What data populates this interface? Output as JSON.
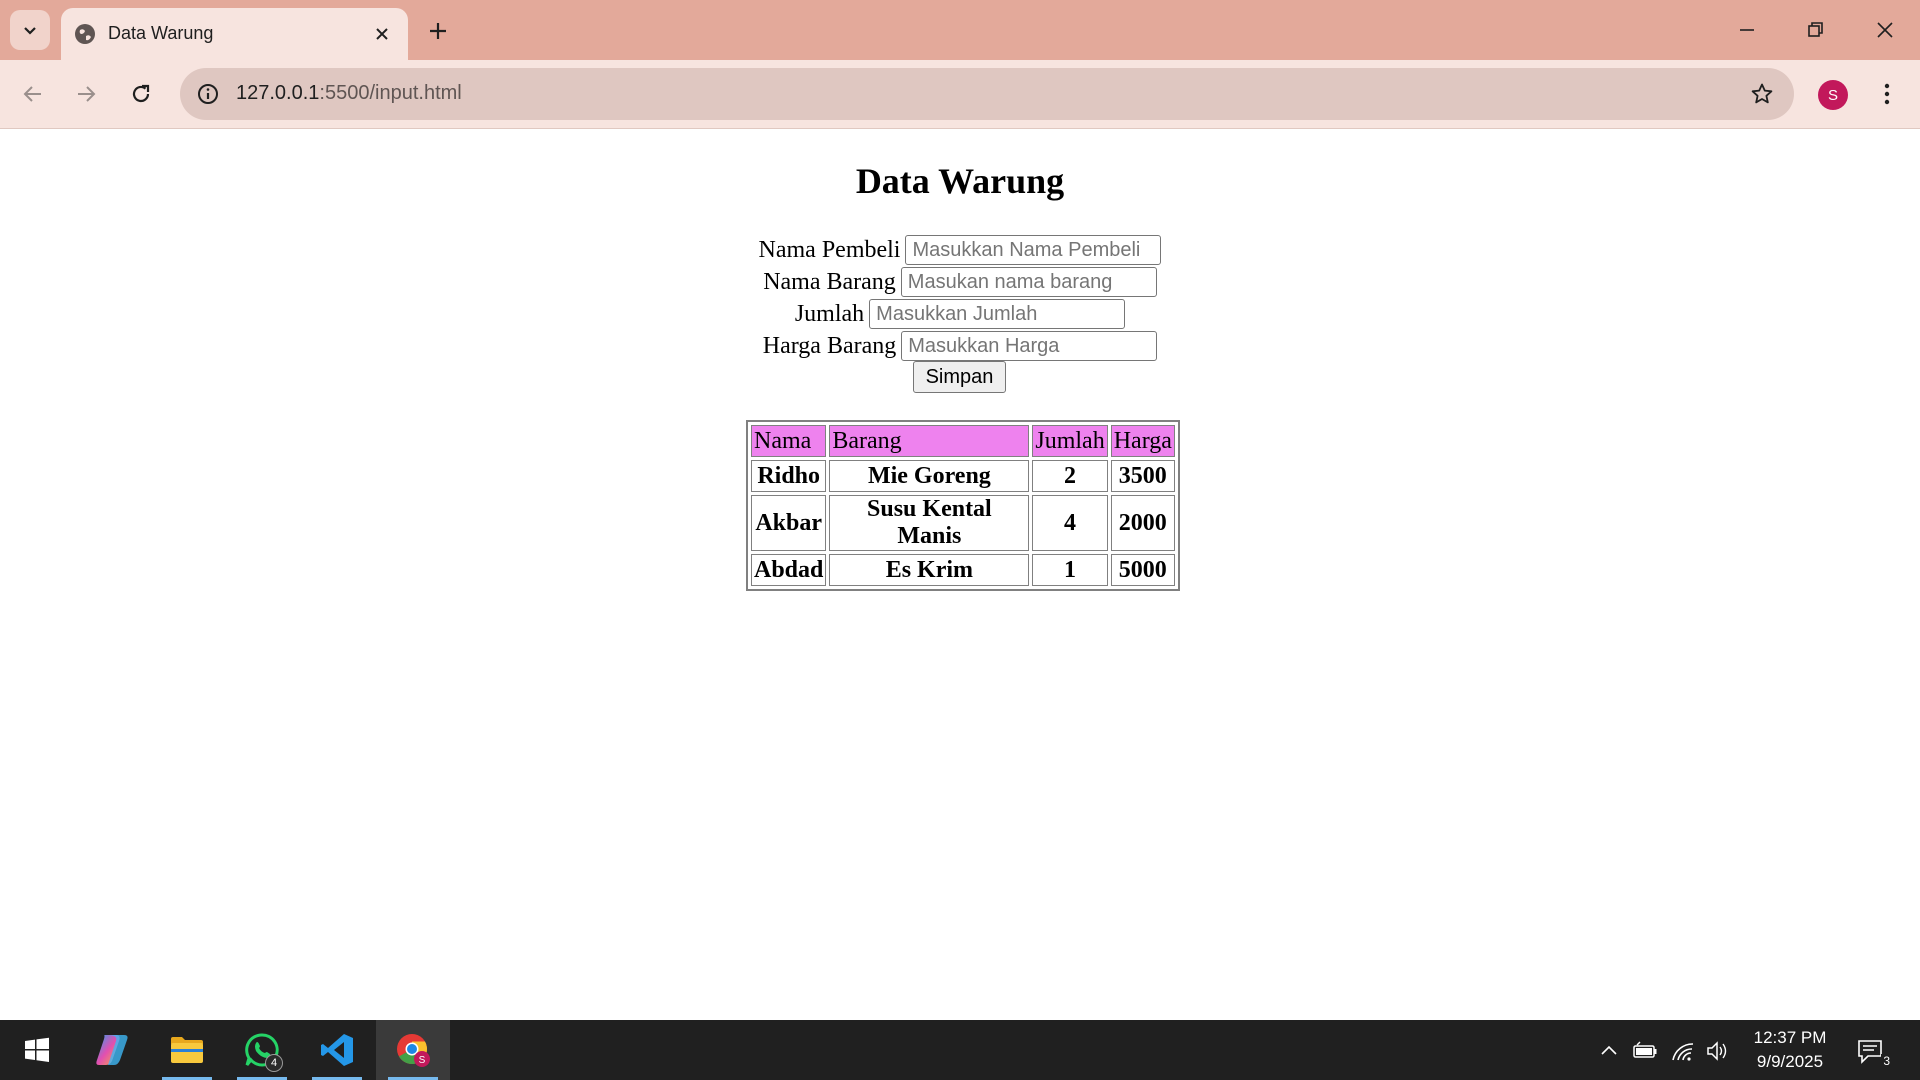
{
  "browser": {
    "tab_title": "Data Warung",
    "url_host": "127.0.0.1",
    "url_path": ":5500/input.html",
    "profile_initial": "S"
  },
  "page": {
    "title": "Data Warung",
    "form": {
      "fields": [
        {
          "label": "Nama Pembeli",
          "placeholder": "Masukkan Nama Pembeli",
          "value": ""
        },
        {
          "label": "Nama Barang",
          "placeholder": "Masukan nama barang",
          "value": ""
        },
        {
          "label": "Jumlah",
          "placeholder": "Masukkan Jumlah",
          "value": ""
        },
        {
          "label": "Harga Barang",
          "placeholder": "Masukkan Harga",
          "value": ""
        }
      ],
      "submit_label": "Simpan"
    },
    "table": {
      "headers": [
        "Nama",
        "Barang",
        "Jumlah",
        "Harga"
      ],
      "rows": [
        [
          "Ridho",
          "Mie Goreng",
          "2",
          "3500"
        ],
        [
          "Akbar",
          "Susu Kental Manis",
          "4",
          "2000"
        ],
        [
          "Abdad",
          "Es Krim",
          "1",
          "5000"
        ]
      ]
    }
  },
  "taskbar": {
    "whatsapp_badge": "4",
    "clock_time": "12:37 PM",
    "clock_date": "9/9/2025",
    "notification_count": "3"
  },
  "colors": {
    "tabbar_bg": "#e3a99a",
    "toolbar_bg": "#f7e4df",
    "table_header_bg": "#ee82ee",
    "profile_bg": "#c2185b"
  }
}
